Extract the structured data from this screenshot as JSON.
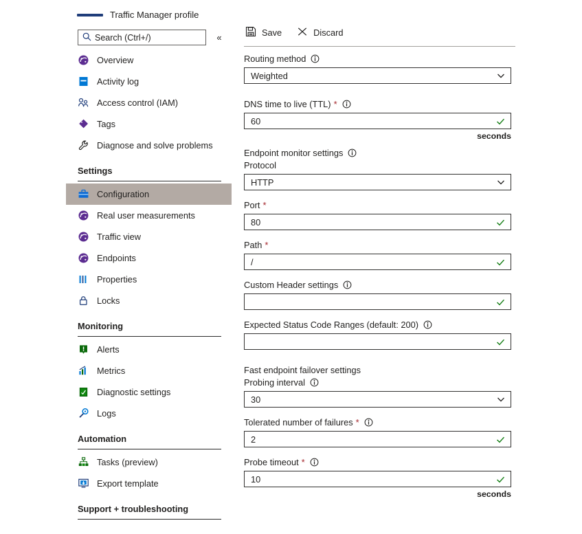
{
  "sidebar": {
    "resource_title": "Traffic Manager profile",
    "search": {
      "placeholder": "Search (Ctrl+/)",
      "value": "",
      "icon": "search-icon"
    },
    "collapse_icon": "«",
    "items": [
      {
        "label": "Overview",
        "icon": "overview-icon",
        "selected": false
      },
      {
        "label": "Activity log",
        "icon": "activity-log-icon",
        "selected": false
      },
      {
        "label": "Access control (IAM)",
        "icon": "access-control-icon",
        "selected": false
      },
      {
        "label": "Tags",
        "icon": "tag-icon",
        "selected": false
      },
      {
        "label": "Diagnose and solve problems",
        "icon": "wrench-icon",
        "selected": false
      }
    ],
    "sections": [
      {
        "title": "Settings",
        "items": [
          {
            "label": "Configuration",
            "icon": "configuration-icon",
            "selected": true
          },
          {
            "label": "Real user measurements",
            "icon": "overview-icon",
            "selected": false
          },
          {
            "label": "Traffic view",
            "icon": "overview-icon",
            "selected": false
          },
          {
            "label": "Endpoints",
            "icon": "overview-icon",
            "selected": false
          },
          {
            "label": "Properties",
            "icon": "properties-icon",
            "selected": false
          },
          {
            "label": "Locks",
            "icon": "lock-icon",
            "selected": false
          }
        ]
      },
      {
        "title": "Monitoring",
        "items": [
          {
            "label": "Alerts",
            "icon": "alerts-icon",
            "selected": false
          },
          {
            "label": "Metrics",
            "icon": "metrics-icon",
            "selected": false
          },
          {
            "label": "Diagnostic settings",
            "icon": "diagnostic-settings-icon",
            "selected": false
          },
          {
            "label": "Logs",
            "icon": "logs-icon",
            "selected": false
          }
        ]
      },
      {
        "title": "Automation",
        "items": [
          {
            "label": "Tasks (preview)",
            "icon": "tasks-icon",
            "selected": false
          },
          {
            "label": "Export template",
            "icon": "export-template-icon",
            "selected": false
          }
        ]
      },
      {
        "title": "Support + troubleshooting",
        "items": []
      }
    ]
  },
  "main": {
    "commands": [
      {
        "label": "Save",
        "icon": "save-icon"
      },
      {
        "label": "Discard",
        "icon": "discard-icon"
      }
    ],
    "fields": {
      "routing_method": {
        "label": "Routing method",
        "value": "Weighted",
        "info_icon": "info-icon",
        "control": "dropdown"
      },
      "dns_ttl": {
        "label": "DNS time to live (TTL)",
        "value": "60",
        "required_marker": "*",
        "info_icon": "info-icon",
        "control": "text",
        "suffix": "seconds"
      },
      "endpoint_monitor_settings": {
        "label": "Endpoint monitor settings",
        "info_icon": "info-icon"
      },
      "protocol": {
        "label": "Protocol",
        "value": "HTTP",
        "control": "dropdown"
      },
      "port": {
        "label": "Port",
        "value": "80",
        "required_marker": "*",
        "control": "text"
      },
      "path": {
        "label": "Path",
        "value": "/",
        "required_marker": "*",
        "control": "text"
      },
      "custom_header_settings": {
        "label": "Custom Header settings",
        "value": "",
        "info_icon": "info-icon",
        "control": "text"
      },
      "expected_status_code_ranges": {
        "label": "Expected Status Code Ranges (default: 200)",
        "value": "",
        "info_icon": "info-icon",
        "control": "text"
      },
      "fast_endpoint_failover_settings": {
        "label": "Fast endpoint failover settings"
      },
      "probing_interval": {
        "label": "Probing interval",
        "value": "30",
        "info_icon": "info-icon",
        "control": "dropdown"
      },
      "tolerated_number_of_failures": {
        "label": "Tolerated number of failures",
        "value": "2",
        "required_marker": "*",
        "info_icon": "info-icon",
        "control": "text"
      },
      "probe_timeout": {
        "label": "Probe timeout",
        "value": "10",
        "required_marker": "*",
        "info_icon": "info-icon",
        "control": "text",
        "suffix": "seconds"
      }
    }
  },
  "colors": {
    "selected_nav_bg": "#b3aaa4",
    "accent_blue": "#1f3d7a",
    "validation_green": "#107c10",
    "required_red": "#a4262c",
    "border": "#323130"
  }
}
